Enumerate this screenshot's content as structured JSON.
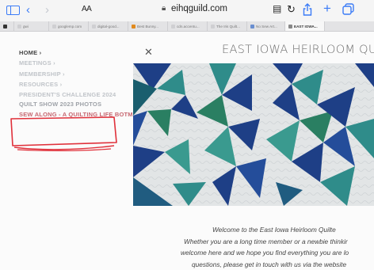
{
  "browser": {
    "text_size_label": "AA",
    "url": "eihqguild.com"
  },
  "tabs": [
    {
      "label": "",
      "color": "#333333",
      "active": false
    },
    {
      "label": "gwi",
      "color": "#cfcfd2",
      "active": false
    },
    {
      "label": "googlemp.com",
      "color": "#cfcfd2",
      "active": false
    },
    {
      "label": "digital-good...",
      "color": "#cfcfd2",
      "active": false
    },
    {
      "label": "Best Bunny...",
      "color": "#e08a1e",
      "active": false
    },
    {
      "label": "cdn.accentu...",
      "color": "#cfcfd2",
      "active": false
    },
    {
      "label": "The Iris Quilt...",
      "color": "#cfcfd2",
      "active": false
    },
    {
      "label": "No Sew Art...",
      "color": "#6a8fd0",
      "active": false
    },
    {
      "label": "EAST IOWA...",
      "color": "#888888",
      "active": true
    }
  ],
  "nav": {
    "items": [
      {
        "label": "HOME",
        "kind": "home"
      },
      {
        "label": "MEETINGS",
        "kind": "chev"
      },
      {
        "label": "MEMBERSHIP",
        "kind": "chev"
      },
      {
        "label": "RESOURCES",
        "kind": "chev"
      },
      {
        "label": "PRESIDENT'S CHALLENGE 2024",
        "kind": "pres"
      },
      {
        "label": "QUILT SHOW 2023 PHOTOS",
        "kind": "quilt"
      },
      {
        "label": "SEW ALONG - A QUILTING LIFE BOTM",
        "kind": "sew"
      }
    ]
  },
  "site": {
    "title": "EAST IOWA HEIRLOOM QUI"
  },
  "welcome_lines": [
    "Welcome to the East Iowa Heirloom Quilte",
    "Whether you are a long time member or a newbie thinkir",
    "welcome here and we hope you find everything you are lo",
    "questions, please get in touch with us via the website"
  ],
  "colors": {
    "accent": "#3a7bf7",
    "annotation": "#e0303a",
    "quilt_navy": "#1e3f86",
    "quilt_teal": "#2f8c8a"
  }
}
